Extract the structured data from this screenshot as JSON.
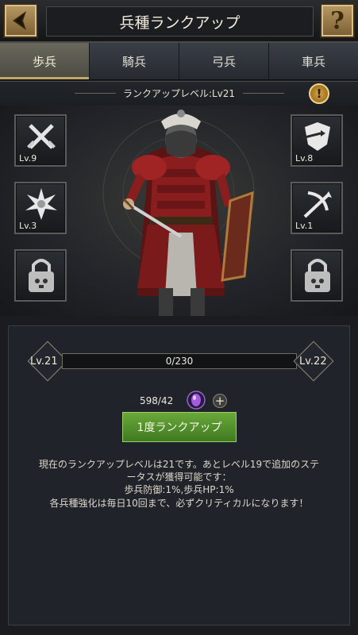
{
  "header": {
    "title": "兵種ランクアップ",
    "help_label": "?"
  },
  "tabs": [
    {
      "label": "歩兵",
      "active": true
    },
    {
      "label": "騎兵",
      "active": false
    },
    {
      "label": "弓兵",
      "active": false
    },
    {
      "label": "車兵",
      "active": false
    }
  ],
  "rank_level_label": "ランクアップレベル:Lv21",
  "info_label": "!",
  "skills": {
    "left": [
      {
        "icon": "crossed-swords-icon",
        "level": "Lv.9"
      },
      {
        "icon": "starburst-icon",
        "level": "Lv.3"
      },
      {
        "icon": "lock-icon",
        "level": ""
      }
    ],
    "right": [
      {
        "icon": "shield-arrow-icon",
        "level": "Lv.8"
      },
      {
        "icon": "broken-arrow-icon",
        "level": "Lv.1"
      },
      {
        "icon": "lock-icon",
        "level": ""
      }
    ]
  },
  "progress": {
    "current_level": "Lv.21",
    "next_level": "Lv.22",
    "text": "0/230",
    "fraction": 0.0
  },
  "cost": {
    "text": "598/42",
    "icon": "purple-gem-icon",
    "plus": "+"
  },
  "rankup_button": "1度ランクアップ",
  "description": {
    "line1": "現在のランクアップレベルは21です。あとレベル19で追加のステ",
    "line2": "ータスが獲得可能です：",
    "line3": "歩兵防御:1%,歩兵HP:1%",
    "line4": "各兵種強化は毎日10回まで、必ずクリティカルになります！"
  },
  "colors": {
    "accent_gold": "#c3a76a",
    "progress_red": "#8a2020",
    "button_green": "#4f8e2b"
  }
}
